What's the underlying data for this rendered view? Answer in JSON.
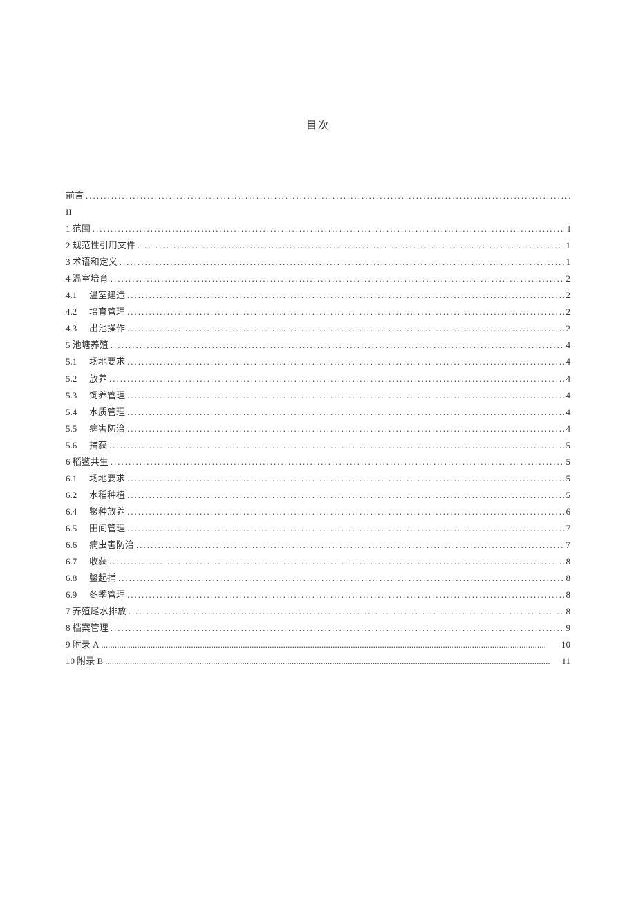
{
  "title": "目次",
  "roman": "II",
  "entries": [
    {
      "label": "前言",
      "page": "",
      "nopage": true
    },
    {
      "label": "1 范围",
      "page": "l"
    },
    {
      "label": "2 规范性引用文件",
      "page": "1"
    },
    {
      "label": "3 术语和定义",
      "page": "1"
    },
    {
      "label": "4 温室培育",
      "page": "2"
    },
    {
      "num": "4.1",
      "text": "温室建造",
      "page": "2",
      "sub": true
    },
    {
      "num": "4.2",
      "text": "培育管理",
      "page": "2",
      "sub": true
    },
    {
      "num": "4.3",
      "text": "出池操作",
      "page": "2",
      "sub": true
    },
    {
      "label": "5 池塘养殖",
      "page": "4"
    },
    {
      "num": "5.1",
      "text": "场地要求",
      "page": "4",
      "sub": true
    },
    {
      "num": "5.2",
      "text": "放养",
      "page": "4",
      "sub": true
    },
    {
      "num": "5.3",
      "text": "饲养管理",
      "page": "4",
      "sub": true
    },
    {
      "num": "5.4",
      "text": "水质管理",
      "page": "4",
      "sub": true
    },
    {
      "num": "5.5",
      "text": "病害防治",
      "page": "4",
      "sub": true
    },
    {
      "num": "5.6",
      "text": "捕获",
      "page": "5",
      "sub": true
    },
    {
      "label": "6 稻鳖共生",
      "page": "5"
    },
    {
      "num": "6.1",
      "text": "场地要求",
      "page": "5",
      "sub": true
    },
    {
      "num": "6.2",
      "text": "水稻种植",
      "page": "5",
      "sub": true
    },
    {
      "num": "6.4",
      "text": "鳖种放养",
      "page": "6",
      "sub": true
    },
    {
      "num": "6.5",
      "text": "田间管理",
      "page": "7",
      "sub": true
    },
    {
      "num": "6.6",
      "text": "病虫害防治",
      "page": "7",
      "sub": true
    },
    {
      "num": "6.7",
      "text": "收获",
      "page": "8",
      "sub": true
    },
    {
      "num": "6.8",
      "text": "鳖起捕",
      "page": "8",
      "sub": true
    },
    {
      "num": "6.9",
      "text": "冬季管理",
      "page": "8",
      "sub": true
    },
    {
      "label": "7 养殖尾水排放",
      "page": "8"
    },
    {
      "label": "8 档案管理",
      "page": "9"
    },
    {
      "label": "9 附录 A",
      "page": "10",
      "thin": true
    },
    {
      "label": "10 附录 B",
      "page": "11",
      "thin": true
    }
  ]
}
